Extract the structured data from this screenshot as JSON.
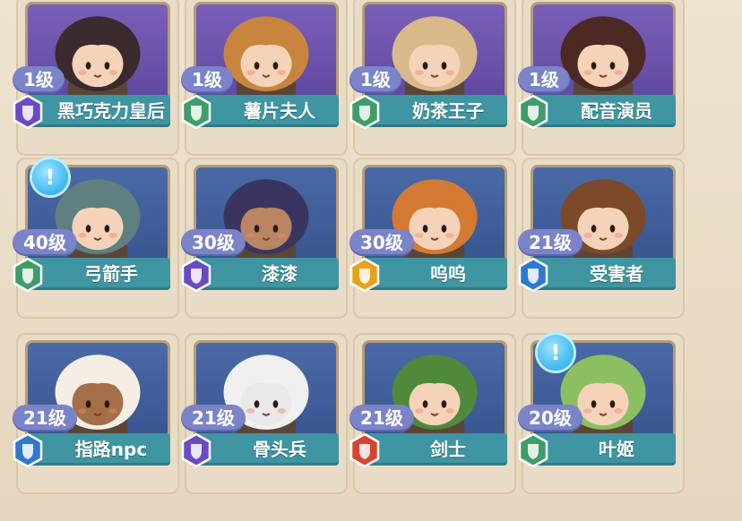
{
  "cards": [
    {
      "level": "1级",
      "name": "黑巧克力皇后",
      "rarity": "purple",
      "bg": "purple",
      "hair": "#3b2a2e",
      "skin": "#f4d3b8"
    },
    {
      "level": "1级",
      "name": "薯片夫人",
      "rarity": "green",
      "bg": "purple",
      "hair": "#c7853d",
      "skin": "#f4d3b8"
    },
    {
      "level": "1级",
      "name": "奶茶王子",
      "rarity": "green",
      "bg": "purple",
      "hair": "#d9b98a",
      "skin": "#f4d3b8"
    },
    {
      "level": "1级",
      "name": "配音演员",
      "rarity": "green",
      "bg": "purple",
      "hair": "#4a2a22",
      "skin": "#f4d3b8"
    },
    {
      "level": "40级",
      "name": "弓箭手",
      "rarity": "green",
      "bg": "blue",
      "hair": "#5f7f80",
      "skin": "#f4d3b8"
    },
    {
      "level": "30级",
      "name": "漆漆",
      "rarity": "purple",
      "bg": "blue",
      "hair": "#3a3560",
      "skin": "#b98563"
    },
    {
      "level": "30级",
      "name": "呜呜",
      "rarity": "gold",
      "bg": "blue",
      "hair": "#d57a33",
      "skin": "#f4d3b8"
    },
    {
      "level": "21级",
      "name": "受害者",
      "rarity": "blue",
      "bg": "blue",
      "hair": "#7a4a2a",
      "skin": "#f4d3b8"
    },
    {
      "level": "21级",
      "name": "指路npc",
      "rarity": "blue",
      "bg": "blue",
      "hair": "#f4eee4",
      "skin": "#a56f4a"
    },
    {
      "level": "21级",
      "name": "骨头兵",
      "rarity": "purple",
      "bg": "blue",
      "hair": "#f0f0f0",
      "skin": "#e9e9e9"
    },
    {
      "level": "21级",
      "name": "剑士",
      "rarity": "red",
      "bg": "blue",
      "hair": "#4e8a3a",
      "skin": "#f4d3b8"
    },
    {
      "level": "20级",
      "name": "叶姬",
      "rarity": "green",
      "bg": "blue",
      "hair": "#8cbf62",
      "skin": "#f4d3b8"
    }
  ],
  "bubbles": [
    {
      "card": 4,
      "symbol": "!"
    },
    {
      "card": 11,
      "symbol": "!"
    }
  ],
  "colors": {
    "purple": "#6a4bc1",
    "green": "#3e9d68",
    "blue": "#2f78d0",
    "gold": "#e6a21d",
    "red": "#d6462f"
  }
}
